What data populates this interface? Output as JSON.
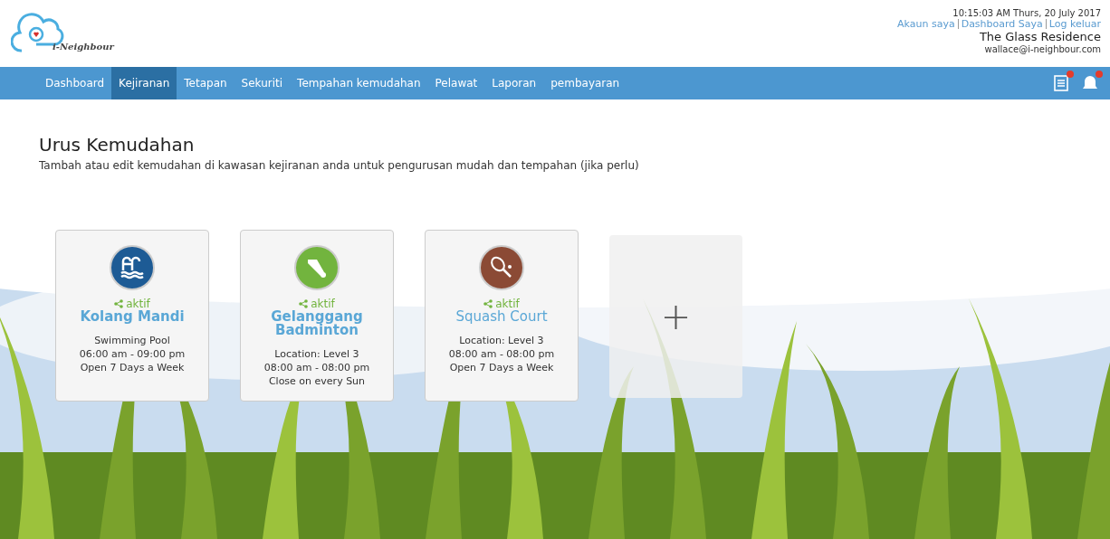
{
  "logo": {
    "text": "i-Neighbour"
  },
  "header": {
    "datetime": "10:15:03 AM  Thurs, 20 July 2017",
    "links": [
      "Akaun saya",
      "Dashboard Saya",
      "Log keluar"
    ],
    "residence": "The Glass Residence",
    "email": "wallace@i-neighbour.com"
  },
  "nav": {
    "items": [
      {
        "label": "Dashboard",
        "selected": false
      },
      {
        "label": "Kejiranan",
        "selected": true
      },
      {
        "label": "Tetapan",
        "selected": false
      },
      {
        "label": "Sekuriti",
        "selected": false
      },
      {
        "label": "Tempahan kemudahan",
        "selected": false
      },
      {
        "label": "Pelawat",
        "selected": false
      },
      {
        "label": "Laporan",
        "selected": false
      },
      {
        "label": "pembayaran",
        "selected": false
      }
    ],
    "icons": [
      {
        "kind": "notes",
        "unread": true
      },
      {
        "kind": "bell",
        "unread": true
      }
    ]
  },
  "page": {
    "title": "Urus Kemudahan",
    "subtitle": "Tambah atau edit kemudahan di kawasan kejiranan anda untuk pengurusan mudah dan tempahan (jika perlu)"
  },
  "facilities": [
    {
      "kind": "pool",
      "color": "#1d5b95",
      "status": "aktif",
      "name": "Kolang Mandi",
      "bold": true,
      "details": [
        "Swimming Pool",
        "06:00 am - 09:00 pm",
        "Open 7 Days a Week"
      ]
    },
    {
      "kind": "badminton",
      "color": "#72b43e",
      "status": "aktif",
      "name": "Gelanggang Badminton",
      "bold": true,
      "details": [
        "Location: Level 3",
        "08:00 am - 08:00 pm",
        "Close on every Sun"
      ]
    },
    {
      "kind": "squash",
      "color": "#8b4a35",
      "status": "aktif",
      "name": "Squash Court",
      "bold": false,
      "details": [
        "Location: Level 3",
        "08:00 am - 08:00 pm",
        "Open 7 Days a Week"
      ]
    }
  ],
  "add_card": {
    "symbol": "+"
  }
}
